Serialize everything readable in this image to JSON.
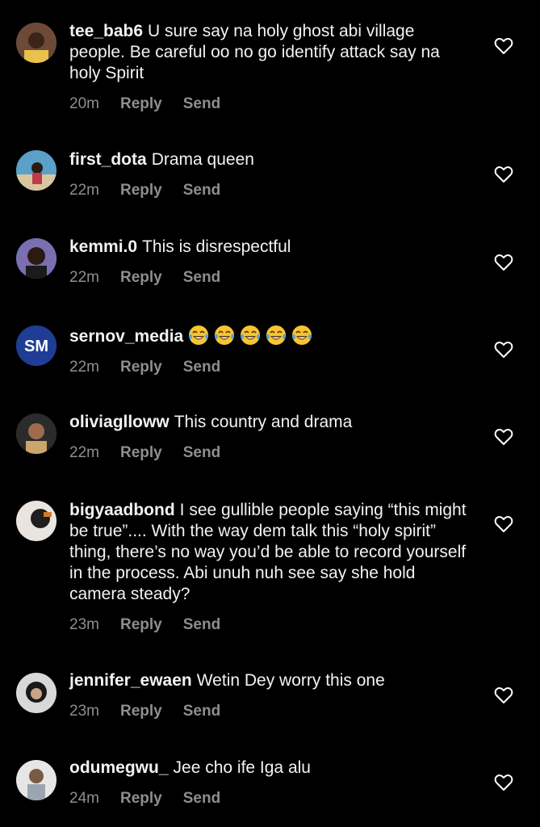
{
  "comments": [
    {
      "username": "tee_bab6",
      "text": "U sure say na holy ghost abi village people. Be careful oo no go identify attack say na holy Spirit",
      "time": "20m",
      "reply": "Reply",
      "send": "Send"
    },
    {
      "username": "first_dota",
      "text": "Drama queen",
      "time": "22m",
      "reply": "Reply",
      "send": "Send"
    },
    {
      "username": "kemmi.0",
      "text": "This is disrespectful",
      "time": "22m",
      "reply": "Reply",
      "send": "Send"
    },
    {
      "username": "sernov_media",
      "text": "",
      "emoji": "laughing-crying-emoji",
      "emoji_count": 5,
      "time": "22m",
      "reply": "Reply",
      "send": "Send"
    },
    {
      "username": "oliviaglloww",
      "text": "This country and drama",
      "time": "22m",
      "reply": "Reply",
      "send": "Send"
    },
    {
      "username": "bigyaadbond",
      "text": "I see gullible people saying “this might be true”.... With the way dem talk this “holy spirit” thing, there’s no way you’d be able to record yourself in the process. Abi unuh nuh see say she hold camera steady?",
      "time": "23m",
      "reply": "Reply",
      "send": "Send"
    },
    {
      "username": "jennifer_ewaen",
      "text": "Wetin Dey worry this one",
      "time": "23m",
      "reply": "Reply",
      "send": "Send"
    },
    {
      "username": "odumegwu_",
      "text": "Jee cho ife Iga alu",
      "time": "24m",
      "reply": "Reply",
      "send": "Send"
    }
  ],
  "icons": {
    "like": "heart-outline-icon"
  },
  "colors": {
    "background": "#000000",
    "text": "#f2f2f2",
    "meta": "#8e8e8e"
  }
}
